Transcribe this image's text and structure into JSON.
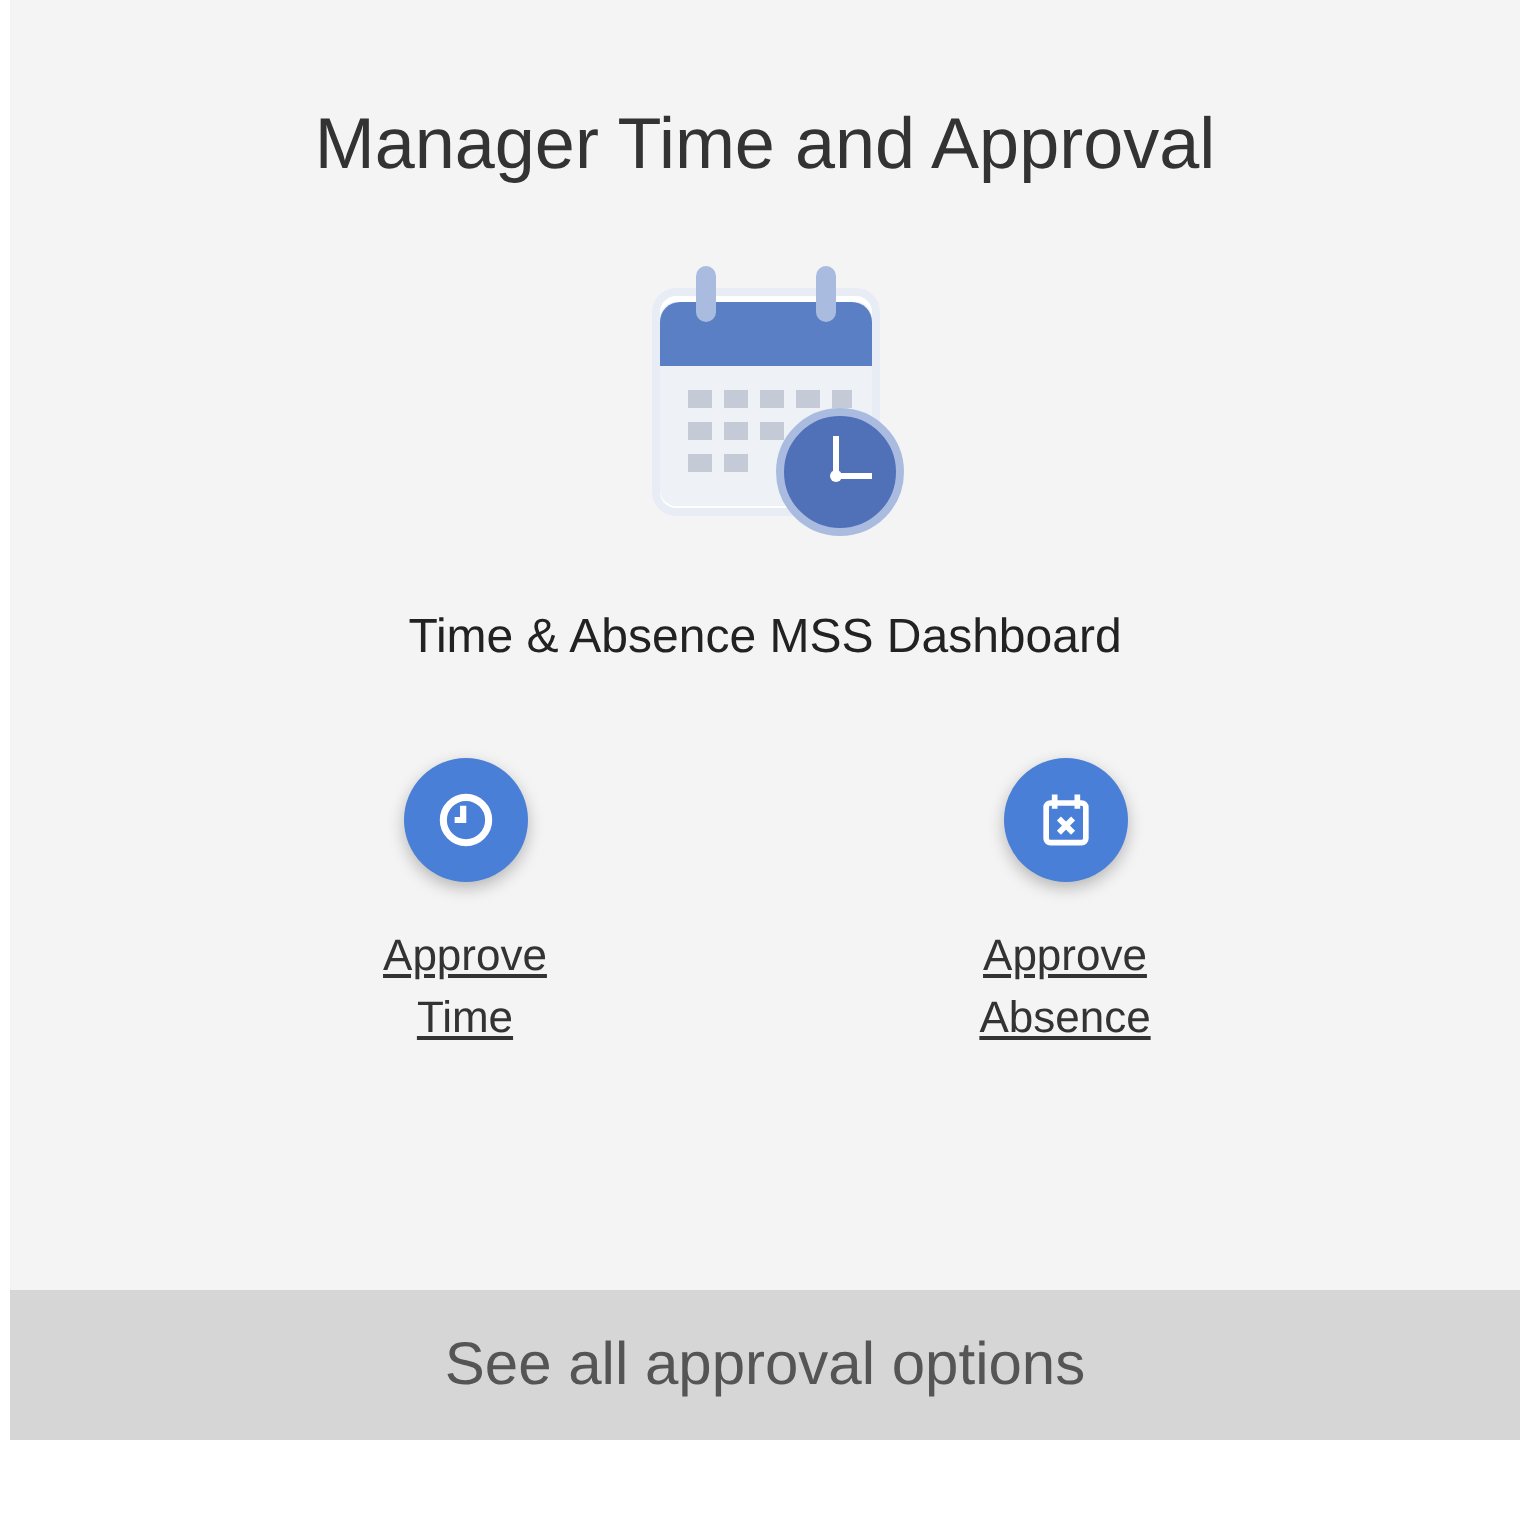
{
  "title": "Manager Time and Approval",
  "dashboard_link": "Time & Absence MSS Dashboard",
  "actions": [
    {
      "kind": "clock",
      "label": "Approve Time"
    },
    {
      "kind": "calendar",
      "label": "Approve Absence"
    }
  ],
  "footer_link": "See all approval options"
}
